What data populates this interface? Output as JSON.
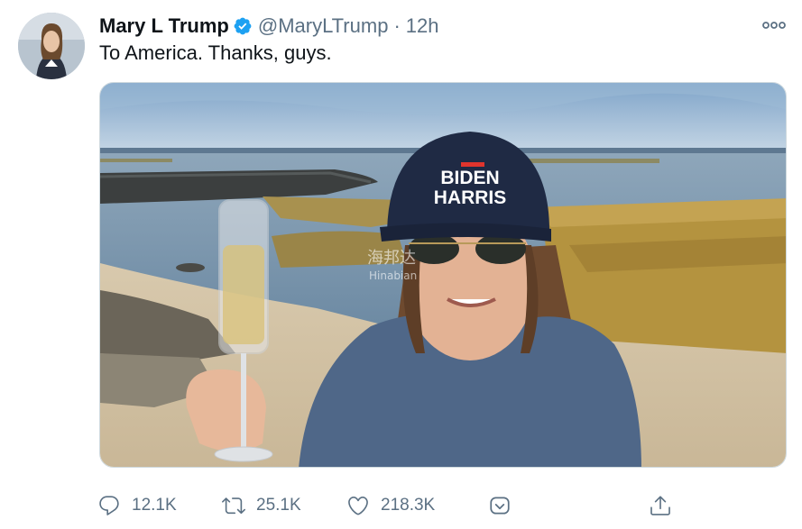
{
  "tweet": {
    "author": {
      "display_name": "Mary L Trump",
      "handle": "@MaryLTrump",
      "verified": true
    },
    "separator": "·",
    "time_ago": "12h",
    "text": "To America. Thanks, guys.",
    "media": {
      "cap_text_line1": "BIDEN",
      "cap_text_line2": "HARRIS",
      "watermark_line1": "海邦达",
      "watermark_line2": "Hinabian"
    },
    "actions": {
      "replies": "12.1K",
      "retweets": "25.1K",
      "likes": "218.3K"
    }
  },
  "colors": {
    "verified_blue": "#1da1f2",
    "secondary_text": "#5b7083",
    "text": "#0f1419",
    "cap_navy": "#1f2a44",
    "cap_red_bar": "#e0342d"
  },
  "icons": [
    "verified-badge-icon",
    "more-options-icon",
    "reply-icon",
    "retweet-icon",
    "like-icon",
    "share-icon",
    "upload-icon"
  ]
}
